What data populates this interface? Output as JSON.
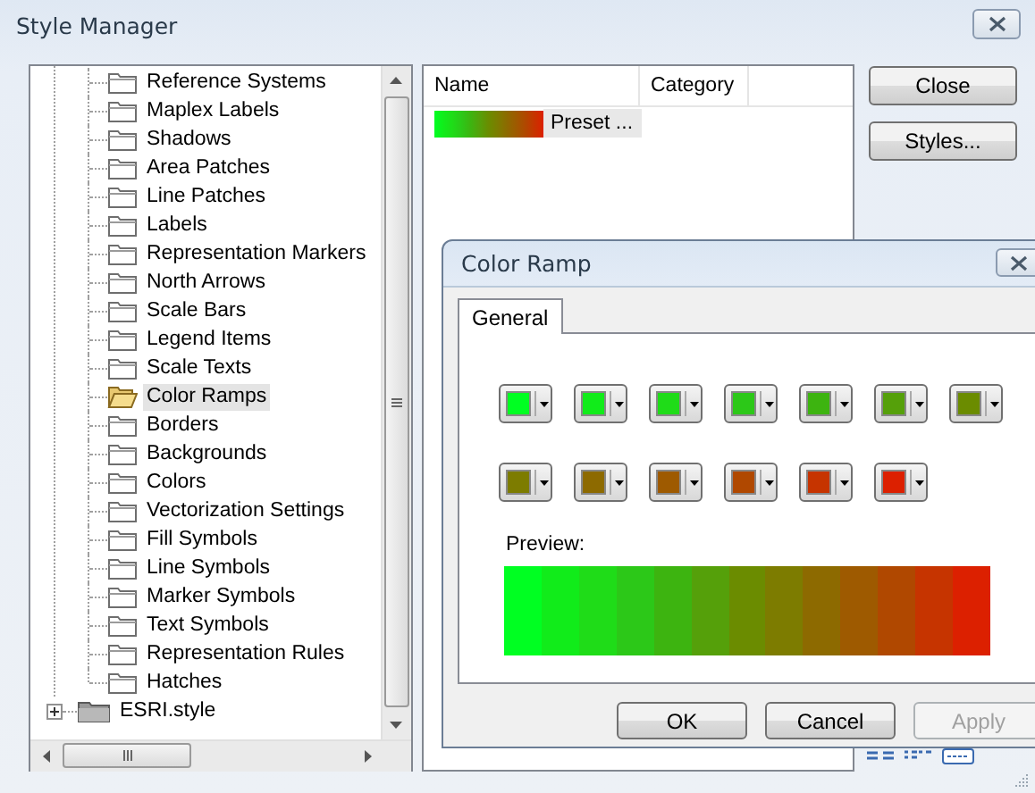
{
  "window": {
    "title": "Style Manager"
  },
  "tree": {
    "items": [
      {
        "label": "Reference Systems",
        "selected": false
      },
      {
        "label": "Maplex Labels",
        "selected": false
      },
      {
        "label": "Shadows",
        "selected": false
      },
      {
        "label": "Area Patches",
        "selected": false
      },
      {
        "label": "Line Patches",
        "selected": false
      },
      {
        "label": "Labels",
        "selected": false
      },
      {
        "label": "Representation Markers",
        "selected": false
      },
      {
        "label": "North Arrows",
        "selected": false
      },
      {
        "label": "Scale Bars",
        "selected": false
      },
      {
        "label": "Legend Items",
        "selected": false
      },
      {
        "label": "Scale Texts",
        "selected": false
      },
      {
        "label": "Color Ramps",
        "selected": true
      },
      {
        "label": "Borders",
        "selected": false
      },
      {
        "label": "Backgrounds",
        "selected": false
      },
      {
        "label": "Colors",
        "selected": false
      },
      {
        "label": "Vectorization Settings",
        "selected": false
      },
      {
        "label": "Fill Symbols",
        "selected": false
      },
      {
        "label": "Line Symbols",
        "selected": false
      },
      {
        "label": "Marker Symbols",
        "selected": false
      },
      {
        "label": "Text Symbols",
        "selected": false
      },
      {
        "label": "Representation Rules",
        "selected": false
      },
      {
        "label": "Hatches",
        "selected": false
      }
    ],
    "root": {
      "label": "ESRI.style",
      "expanded": false
    }
  },
  "list": {
    "columns": [
      "Name",
      "Category"
    ],
    "rows": [
      {
        "name": "Preset ..."
      }
    ]
  },
  "buttons": [
    {
      "label": "Close"
    },
    {
      "label": "Styles..."
    }
  ],
  "dialog": {
    "title": "Color Ramp",
    "tabs": [
      {
        "label": "General",
        "selected": true
      }
    ],
    "colors": [
      {
        "color": "#00ff22"
      },
      {
        "color": "#11ec1a"
      },
      {
        "color": "#1fdc18"
      },
      {
        "color": "#2cc818"
      },
      {
        "color": "#3db410"
      },
      {
        "color": "#55a00a"
      },
      {
        "color": "#6b8c00"
      },
      {
        "color": "#7d7c00"
      },
      {
        "color": "#8d6a00"
      },
      {
        "color": "#9e5a00"
      },
      {
        "color": "#b04800"
      },
      {
        "color": "#c63400"
      },
      {
        "color": "#dc2000"
      }
    ],
    "preview_label": "Preview:",
    "buttons": [
      {
        "label": "OK",
        "disabled": false
      },
      {
        "label": "Cancel",
        "disabled": false
      },
      {
        "label": "Apply",
        "disabled": true
      }
    ]
  }
}
